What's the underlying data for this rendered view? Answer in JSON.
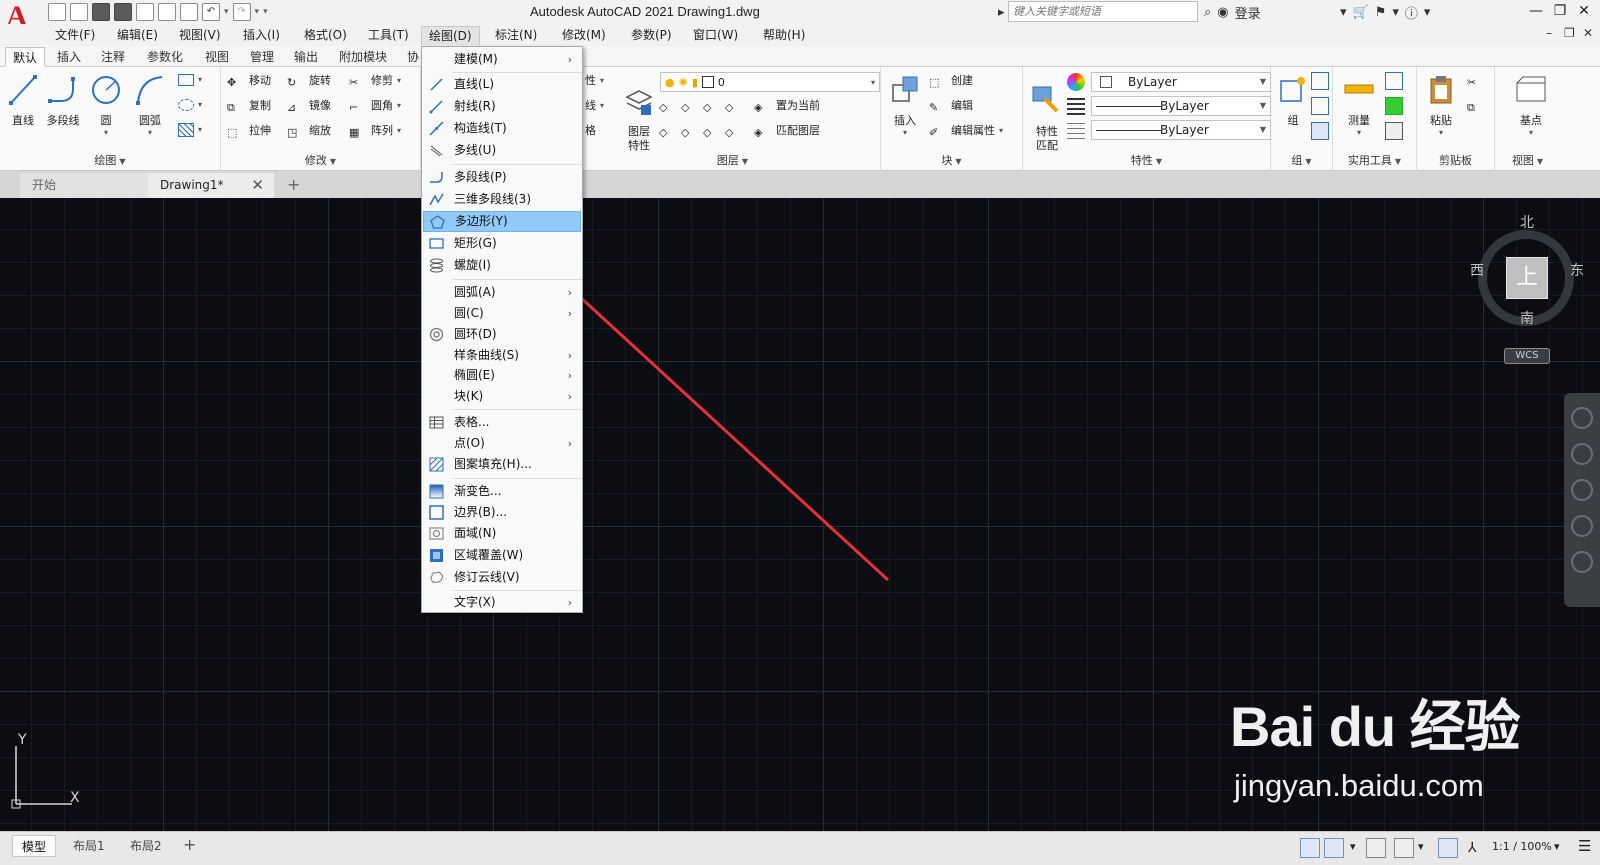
{
  "window": {
    "title": "Autodesk AutoCAD 2021    Drawing1.dwg",
    "search_placeholder": "键入关键字或短语",
    "signin": "登录"
  },
  "menubar": [
    "文件(F)",
    "编辑(E)",
    "视图(V)",
    "插入(I)",
    "格式(O)",
    "工具(T)",
    "绘图(D)",
    "标注(N)",
    "修改(M)",
    "参数(P)",
    "窗口(W)",
    "帮助(H)"
  ],
  "ribbon_tabs": [
    "默认",
    "插入",
    "注释",
    "参数化",
    "视图",
    "管理",
    "输出",
    "附加模块",
    "协"
  ],
  "ribbon": {
    "draw": {
      "title": "绘图",
      "line": "直线",
      "polyline": "多段线",
      "circle": "圆",
      "arc": "圆弧"
    },
    "modify": {
      "title": "修改",
      "move": "移动",
      "rotate": "旋转",
      "trim": "修剪",
      "copy": "复制",
      "mirror": "镜像",
      "fillet": "圆角",
      "stretch": "拉伸",
      "scale": "缩放",
      "array": "阵列"
    },
    "layers": {
      "title": "图层",
      "current_layer": "0",
      "partial_label_1": "性",
      "partial_label_2": "线",
      "partial_label_3": "格",
      "layer_props": "图层\n特性",
      "set_current": "置为当前",
      "match_layer": "匹配图层"
    },
    "block": {
      "title": "块",
      "insert": "插入",
      "create": "创建",
      "edit": "编辑",
      "edit_attr": "编辑属性"
    },
    "properties": {
      "title": "特性",
      "match": "特性\n匹配",
      "color": "ByLayer",
      "lineweight": "ByLayer",
      "linetype": "ByLayer"
    },
    "group": {
      "title": "组",
      "label": "组"
    },
    "utilities": {
      "title": "实用工具",
      "measure": "测量"
    },
    "clipboard": {
      "title": "剪贴板",
      "paste": "粘贴"
    },
    "view": {
      "title": "视图",
      "base": "基点"
    }
  },
  "file_tabs": {
    "start": "开始",
    "doc": "Drawing1*"
  },
  "draw_menu": {
    "items": [
      {
        "label": "建模(M)",
        "submenu": true
      },
      {
        "label": "直线(L)"
      },
      {
        "label": "射线(R)"
      },
      {
        "label": "构造线(T)"
      },
      {
        "label": "多线(U)"
      },
      {
        "label": "多段线(P)"
      },
      {
        "label": "三维多段线(3)"
      },
      {
        "label": "多边形(Y)",
        "highlighted": true
      },
      {
        "label": "矩形(G)"
      },
      {
        "label": "螺旋(I)"
      },
      {
        "label": "圆弧(A)",
        "submenu": true
      },
      {
        "label": "圆(C)",
        "submenu": true
      },
      {
        "label": "圆环(D)"
      },
      {
        "label": "样条曲线(S)",
        "submenu": true
      },
      {
        "label": "椭圆(E)",
        "submenu": true
      },
      {
        "label": "块(K)",
        "submenu": true
      },
      {
        "label": "表格..."
      },
      {
        "label": "点(O)",
        "submenu": true
      },
      {
        "label": "图案填充(H)..."
      },
      {
        "label": "渐变色..."
      },
      {
        "label": "边界(B)..."
      },
      {
        "label": "面域(N)"
      },
      {
        "label": "区域覆盖(W)"
      },
      {
        "label": "修订云线(V)"
      },
      {
        "label": "文字(X)",
        "submenu": true
      }
    ]
  },
  "viewcube": {
    "north": "北",
    "south": "南",
    "east": "东",
    "west": "西",
    "face": "上",
    "wcs": "WCS"
  },
  "ucs": {
    "x": "X",
    "y": "Y"
  },
  "watermark": {
    "main": "Bai du 经验",
    "url": "jingyan.baidu.com"
  },
  "statusbar": {
    "layouts": [
      "模型",
      "布局1",
      "布局2"
    ],
    "scale": "1:1 / 100%"
  },
  "colors": {
    "canvas_bg": "#0b0d12",
    "menu_highlight": "#91c9f7",
    "annotation_arrow": "#e8303a",
    "logo": "#d02026"
  }
}
